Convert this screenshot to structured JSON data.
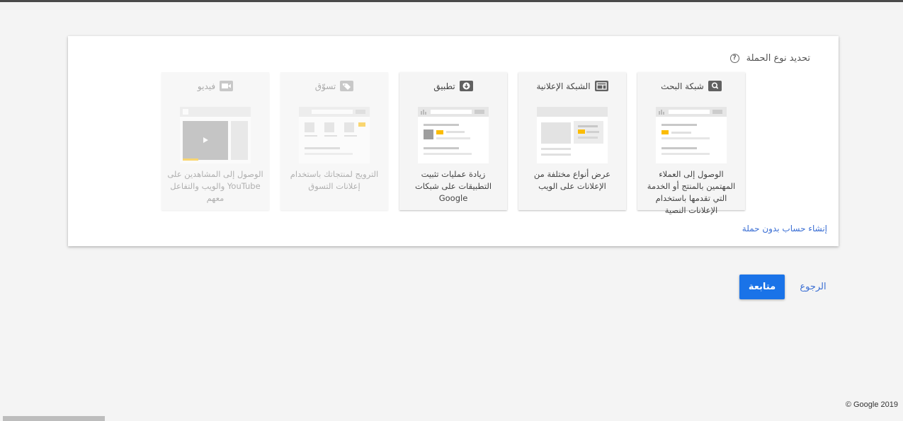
{
  "heading": {
    "label": "تحديد نوع الحملة",
    "help_icon": "help-circle-icon"
  },
  "cards": [
    {
      "id": "search",
      "title": "شبكة البحث",
      "icon": "search-icon",
      "description": "الوصول إلى العملاء المهتمين بالمنتج أو الخدمة التي تقدمها باستخدام الإعلانات النصية",
      "enabled": true
    },
    {
      "id": "display",
      "title": "الشبكة الإعلانية",
      "icon": "display-icon",
      "description": "عرض أنواع مختلفة من الإعلانات على الويب",
      "enabled": true
    },
    {
      "id": "app",
      "title": "تطبيق",
      "icon": "download-icon",
      "description": "زيادة عمليات تثبيت التطبيقات على شبكات Google",
      "enabled": true
    },
    {
      "id": "shopping",
      "title": "تسوّق",
      "icon": "tag-icon",
      "description": "الترويج لمنتجاتك باستخدام إعلانات التسوق",
      "enabled": false
    },
    {
      "id": "video",
      "title": "فيديو",
      "icon": "video-camera-icon",
      "description": "الوصول إلى المشاهدين على YouTube والويب والتفاعل معهم",
      "enabled": false
    }
  ],
  "create_account_link": "إنشاء حساب بدون حملة",
  "buttons": {
    "continue": "متابعة",
    "back": "الرجوع"
  },
  "footer": "© Google 2019",
  "colors": {
    "primary": "#1a73e8",
    "link": "#3b6fd4",
    "accent": "#fbbc04",
    "background": "#f4f4f4"
  }
}
